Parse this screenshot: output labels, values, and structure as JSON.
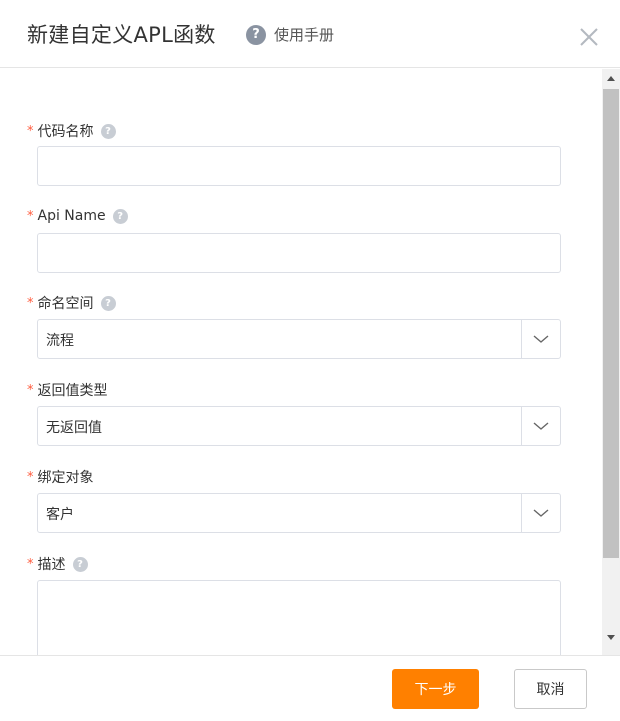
{
  "dialog": {
    "title": "新建自定义APL函数",
    "help_label": "使用手册",
    "help_glyph": "?"
  },
  "fields": {
    "code_name": {
      "label": "代码名称",
      "required_mark": "*",
      "value": ""
    },
    "api_name": {
      "label": "Api Name",
      "required_mark": "*",
      "value": ""
    },
    "namespace": {
      "label": "命名空间",
      "required_mark": "*",
      "value": "流程"
    },
    "return_type": {
      "label": "返回值类型",
      "required_mark": "*",
      "value": "无返回值"
    },
    "bind_object": {
      "label": "绑定对象",
      "required_mark": "*",
      "value": "客户"
    },
    "description": {
      "label": "描述",
      "required_mark": "*",
      "value": ""
    }
  },
  "footer": {
    "next_label": "下一步",
    "cancel_label": "取消"
  },
  "colors": {
    "primary": "#ff8000",
    "required": "#ff5a3c",
    "help_icon": "#8a93a1"
  }
}
